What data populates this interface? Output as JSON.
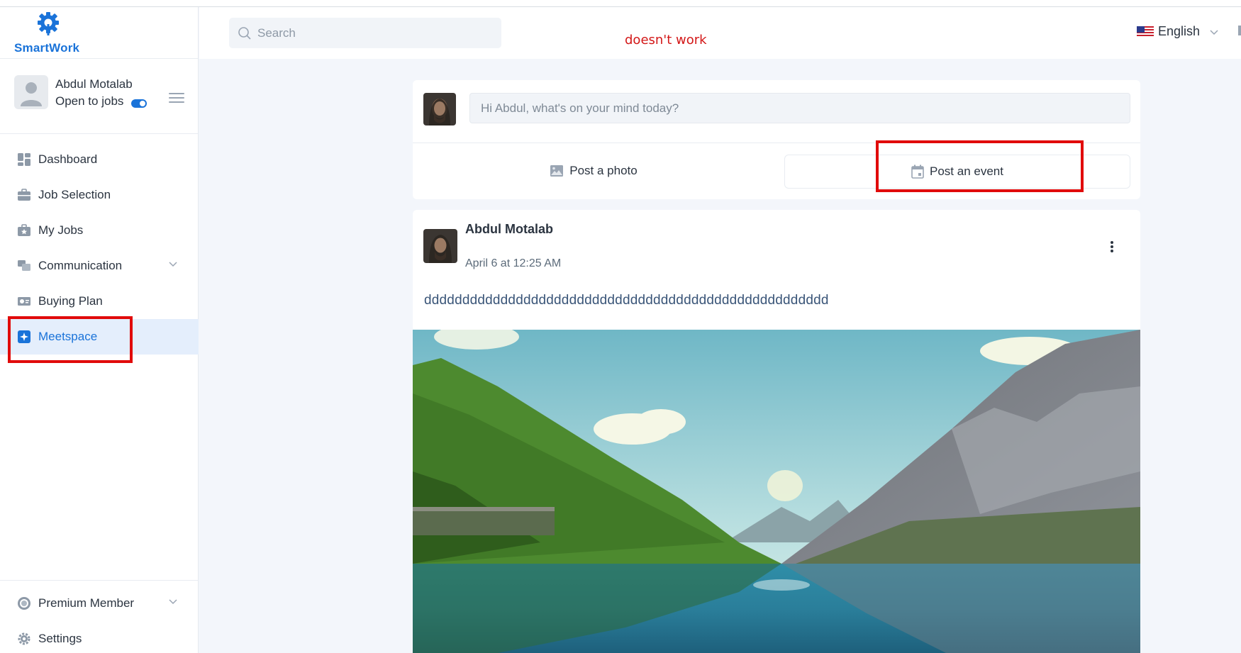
{
  "brand": {
    "name": "SmartWork"
  },
  "profile": {
    "name": "Abdul Motalab",
    "status": "Open to jobs"
  },
  "nav": {
    "items": [
      {
        "label": "Dashboard"
      },
      {
        "label": "Job Selection"
      },
      {
        "label": "My Jobs"
      },
      {
        "label": "Communication"
      },
      {
        "label": "Buying Plan"
      },
      {
        "label": "Meetspace"
      }
    ],
    "bottom": [
      {
        "label": "Premium Member"
      },
      {
        "label": "Settings"
      }
    ]
  },
  "header": {
    "search_placeholder": "Search",
    "note": "doesn't work",
    "language": "English"
  },
  "composer": {
    "placeholder": "Hi Abdul, what's on your mind today?",
    "photo_label": "Post a photo",
    "event_label": "Post an event"
  },
  "post": {
    "author": "Abdul Motalab",
    "time": "April 6 at 12:25 AM",
    "text": "ddddddddddddddddddddddddddddddddddddddddddddddddddddd"
  },
  "colors": {
    "accent": "#1a73d9",
    "annotation": "#e10b0b"
  }
}
